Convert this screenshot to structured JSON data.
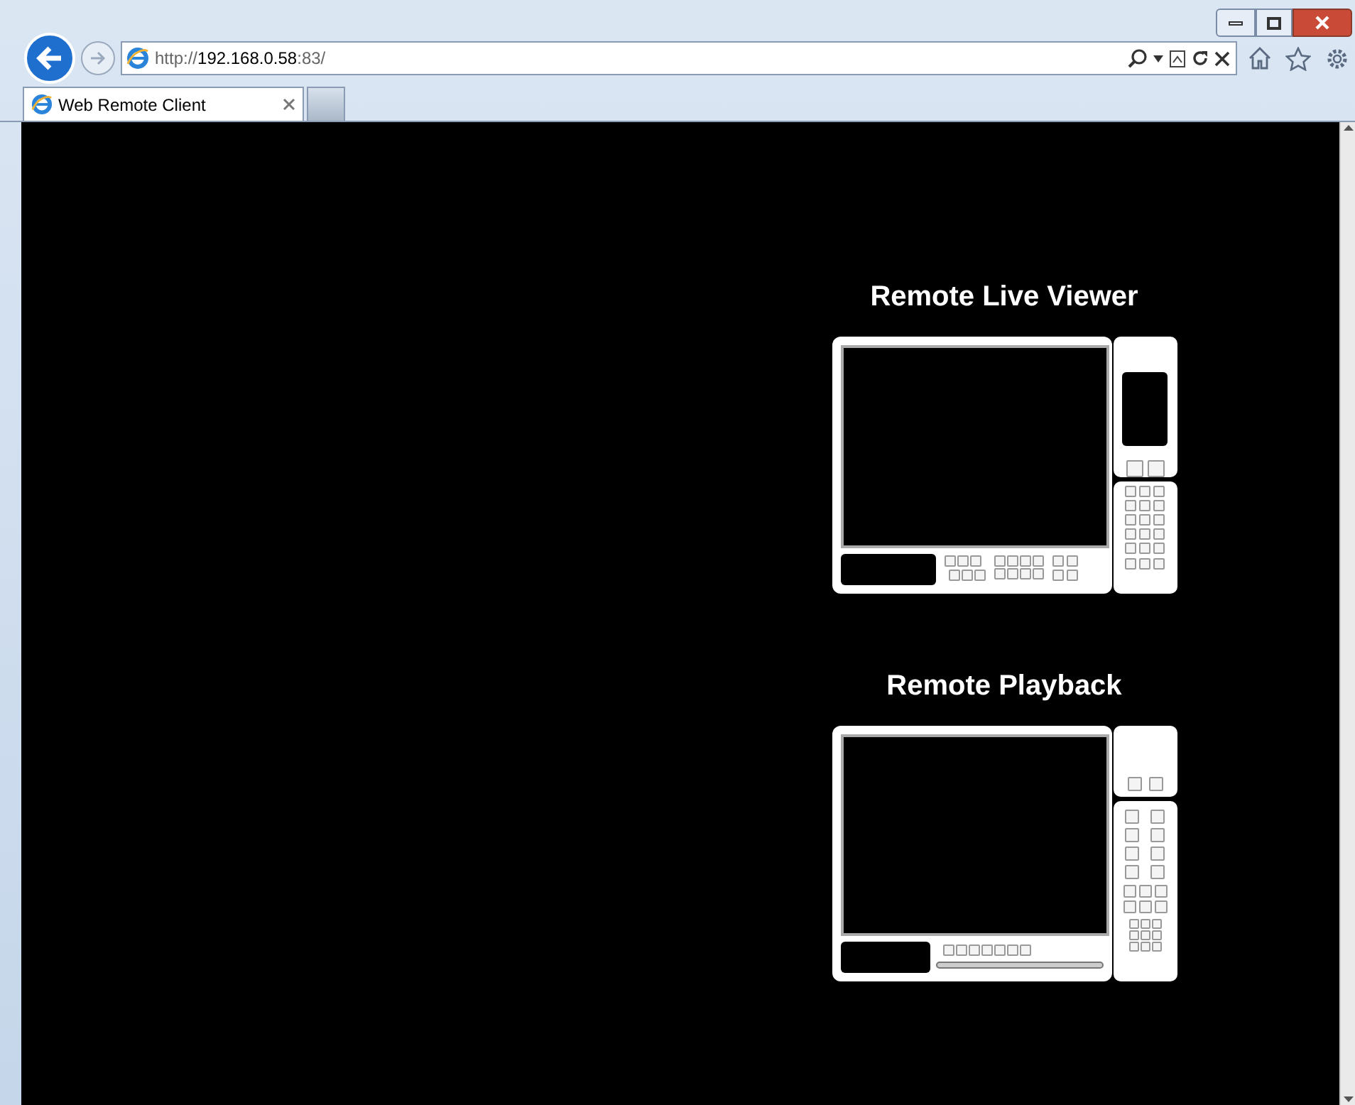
{
  "address_bar": {
    "url_scheme": "http://",
    "url_host": "192.168.0.58",
    "url_rest": ":83/"
  },
  "tabs": [
    {
      "label": "Web Remote Client",
      "selected": true
    }
  ],
  "sections": [
    {
      "kind": "live",
      "title": "Remote Live Viewer"
    },
    {
      "kind": "playback",
      "title": "Remote Playback"
    }
  ]
}
